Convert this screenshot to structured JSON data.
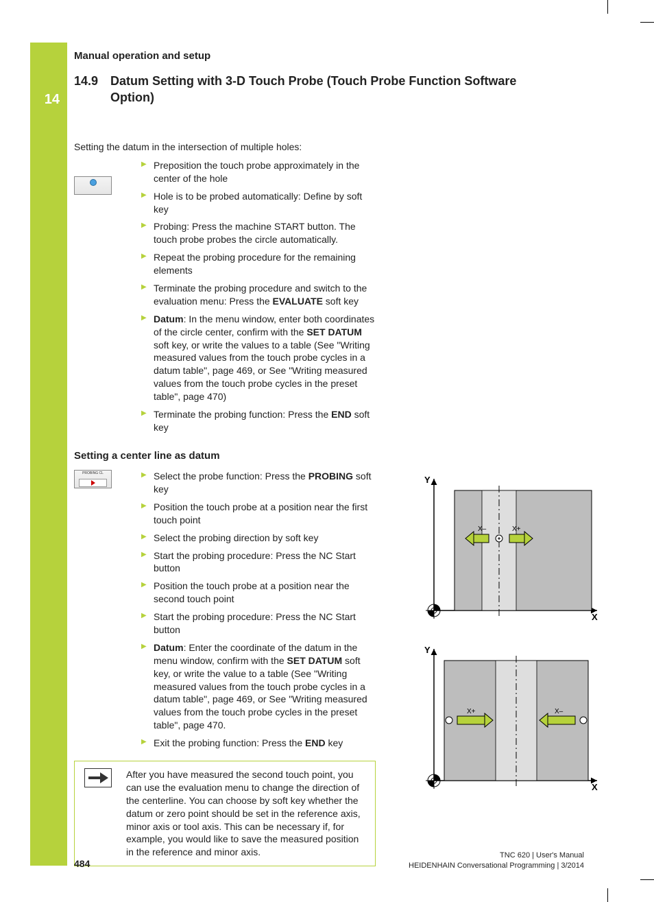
{
  "chapter_number": "14",
  "running_head": "Manual operation and setup",
  "section_number": "14.9",
  "section_title": "Datum Setting with 3-D Touch Probe (Touch Probe Function Software Option)",
  "intro": "Setting the datum in the intersection of multiple holes:",
  "steps1": {
    "i0": "Preposition the touch probe approximately in the center of the hole",
    "i1": "Hole is to be probed automatically: Define by soft key",
    "i2": "Probing: Press the machine START button. The touch probe probes the circle automatically.",
    "i3": "Repeat the probing procedure for the remaining elements",
    "i4_a": "Terminate the probing procedure and switch to the evaluation menu: Press the ",
    "i4_b": "EVALUATE",
    "i4_c": " soft key",
    "i5_a": "Datum",
    "i5_b": ": In the menu window, enter both coordinates of the circle center, confirm with the ",
    "i5_c": "SET DATUM",
    "i5_d": " soft key, or write the values to a table (See \"Writing measured values from the touch probe cycles in a datum table\", page 469, or See \"Writing measured values from the touch probe cycles in the preset table\", page 470)",
    "i6_a": "Terminate the probing function: Press the ",
    "i6_b": "END",
    "i6_c": " soft key"
  },
  "subhead": "Setting a center line as datum",
  "softkey2_label": "PROBING CL",
  "steps2": {
    "i0_a": "Select the probe function: Press the ",
    "i0_b": "PROBING",
    "i0_c": " soft key",
    "i1": "Position the touch probe at a position near the first touch point",
    "i2": "Select the probing direction by soft key",
    "i3": "Start the probing procedure: Press the NC Start button",
    "i4": "Position the touch probe at a position near the second touch point",
    "i5": "Start the probing procedure: Press the NC Start button",
    "i6_a": "Datum",
    "i6_b": ": Enter the coordinate of the datum in the menu window, confirm with the ",
    "i6_c": "SET DATUM",
    "i6_d": " soft key, or write the value to a table (See \"Writing measured values from the touch probe cycles in a datum table\", page 469, or See \"Writing measured values from the touch probe cycles in the preset table\", page 470.",
    "i7_a": "Exit the probing function: Press the ",
    "i7_b": "END",
    "i7_c": " key"
  },
  "note": "After you have measured the second touch point, you can use the evaluation menu to change the direction of the centerline. You can choose by soft key whether the datum or zero point should be set in the reference axis, minor axis or tool axis. This can be necessary if, for example, you would like to save the measured position in the reference and minor axis.",
  "diagram_labels": {
    "Y": "Y",
    "X": "X",
    "Xminus": "X–",
    "Xplus": "X+"
  },
  "page_number": "484",
  "footer_line1": "TNC 620 | User's Manual",
  "footer_line2": "HEIDENHAIN Conversational Programming | 3/2014"
}
